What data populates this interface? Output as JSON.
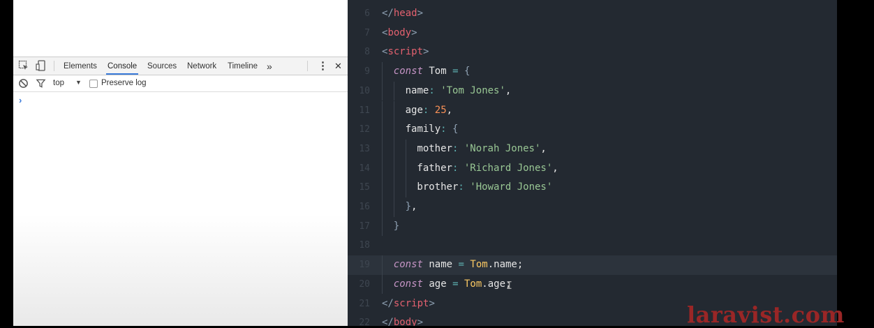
{
  "devtools": {
    "tabs": [
      "Elements",
      "Console",
      "Sources",
      "Network",
      "Timeline"
    ],
    "active_tab": "Console",
    "more_tabs": "»",
    "menu_icon": "⋮",
    "close_icon": "✕",
    "context": "top",
    "preserve_log_label": "Preserve log",
    "prompt_symbol": "›"
  },
  "editor": {
    "lines": [
      {
        "num": "6",
        "tokens": [
          [
            "tag-br",
            "</"
          ],
          [
            "tag",
            "head"
          ],
          [
            "tag-br",
            ">"
          ]
        ]
      },
      {
        "num": "7",
        "tokens": [
          [
            "tag-br",
            "<"
          ],
          [
            "tag",
            "body"
          ],
          [
            "tag-br",
            ">"
          ]
        ]
      },
      {
        "num": "8",
        "tokens": [
          [
            "tag-br",
            "<"
          ],
          [
            "tag",
            "script"
          ],
          [
            "tag-br",
            ">"
          ]
        ]
      },
      {
        "num": "9",
        "indent": 1,
        "tokens": [
          [
            "kw",
            "const"
          ],
          [
            "pl",
            " Tom "
          ],
          [
            "op",
            "="
          ],
          [
            "pl",
            " "
          ],
          [
            "br",
            "{"
          ]
        ]
      },
      {
        "num": "10",
        "indent": 2,
        "tokens": [
          [
            "pl",
            "name"
          ],
          [
            "op",
            ":"
          ],
          [
            "pl",
            " "
          ],
          [
            "str",
            "'Tom Jones'"
          ],
          [
            "pl",
            ","
          ]
        ]
      },
      {
        "num": "11",
        "indent": 2,
        "tokens": [
          [
            "pl",
            "age"
          ],
          [
            "op",
            ":"
          ],
          [
            "pl",
            " "
          ],
          [
            "num",
            "25"
          ],
          [
            "pl",
            ","
          ]
        ]
      },
      {
        "num": "12",
        "indent": 2,
        "tokens": [
          [
            "pl",
            "family"
          ],
          [
            "op",
            ":"
          ],
          [
            "pl",
            " "
          ],
          [
            "br",
            "{"
          ]
        ]
      },
      {
        "num": "13",
        "indent": 3,
        "tokens": [
          [
            "pl",
            "mother"
          ],
          [
            "op",
            ":"
          ],
          [
            "pl",
            " "
          ],
          [
            "str",
            "'Norah Jones'"
          ],
          [
            "pl",
            ","
          ]
        ]
      },
      {
        "num": "14",
        "indent": 3,
        "tokens": [
          [
            "pl",
            "father"
          ],
          [
            "op",
            ":"
          ],
          [
            "pl",
            " "
          ],
          [
            "str",
            "'Richard Jones'"
          ],
          [
            "pl",
            ","
          ]
        ]
      },
      {
        "num": "15",
        "indent": 3,
        "tokens": [
          [
            "pl",
            "brother"
          ],
          [
            "op",
            ":"
          ],
          [
            "pl",
            " "
          ],
          [
            "str",
            "'Howard Jones'"
          ]
        ]
      },
      {
        "num": "16",
        "indent": 2,
        "tokens": [
          [
            "br",
            "}"
          ],
          [
            "pl",
            ","
          ]
        ]
      },
      {
        "num": "17",
        "indent": 1,
        "tokens": [
          [
            "br",
            "}"
          ]
        ]
      },
      {
        "num": "18",
        "tokens": []
      },
      {
        "num": "19",
        "indent": 1,
        "current": true,
        "tokens": [
          [
            "kw",
            "const"
          ],
          [
            "pl",
            " name "
          ],
          [
            "op",
            "="
          ],
          [
            "pl",
            " "
          ],
          [
            "obj",
            "Tom"
          ],
          [
            "pl",
            "."
          ],
          [
            "pl",
            "name;"
          ]
        ]
      },
      {
        "num": "20",
        "indent": 1,
        "tokens": [
          [
            "kw",
            "const"
          ],
          [
            "pl",
            " age "
          ],
          [
            "op",
            "="
          ],
          [
            "pl",
            " "
          ],
          [
            "obj",
            "Tom"
          ],
          [
            "pl",
            "."
          ],
          [
            "pl",
            "age;"
          ]
        ]
      },
      {
        "num": "21",
        "tokens": [
          [
            "tag-br",
            "</"
          ],
          [
            "tag",
            "script"
          ],
          [
            "tag-br",
            ">"
          ]
        ]
      },
      {
        "num": "22",
        "tokens": [
          [
            "tag-br",
            "</"
          ],
          [
            "tag",
            "body"
          ],
          [
            "tag-br",
            ">"
          ]
        ]
      }
    ]
  },
  "watermark": "laravist.com",
  "colors": {
    "editor_bg": "#232931",
    "tag": "#e3616f",
    "keyword": "#c594c5",
    "string": "#99c794",
    "number": "#f99157",
    "object": "#fac863",
    "operator": "#5fb3b3",
    "devtools_accent": "#3879d9",
    "watermark": "#9a2626"
  },
  "icons": [
    "inspect-element-icon",
    "device-toolbar-icon",
    "clear-console-icon",
    "filter-icon",
    "dropdown-arrow-icon",
    "more-tabs-icon",
    "kebab-menu-icon",
    "close-icon",
    "console-prompt-icon",
    "text-cursor-icon"
  ]
}
